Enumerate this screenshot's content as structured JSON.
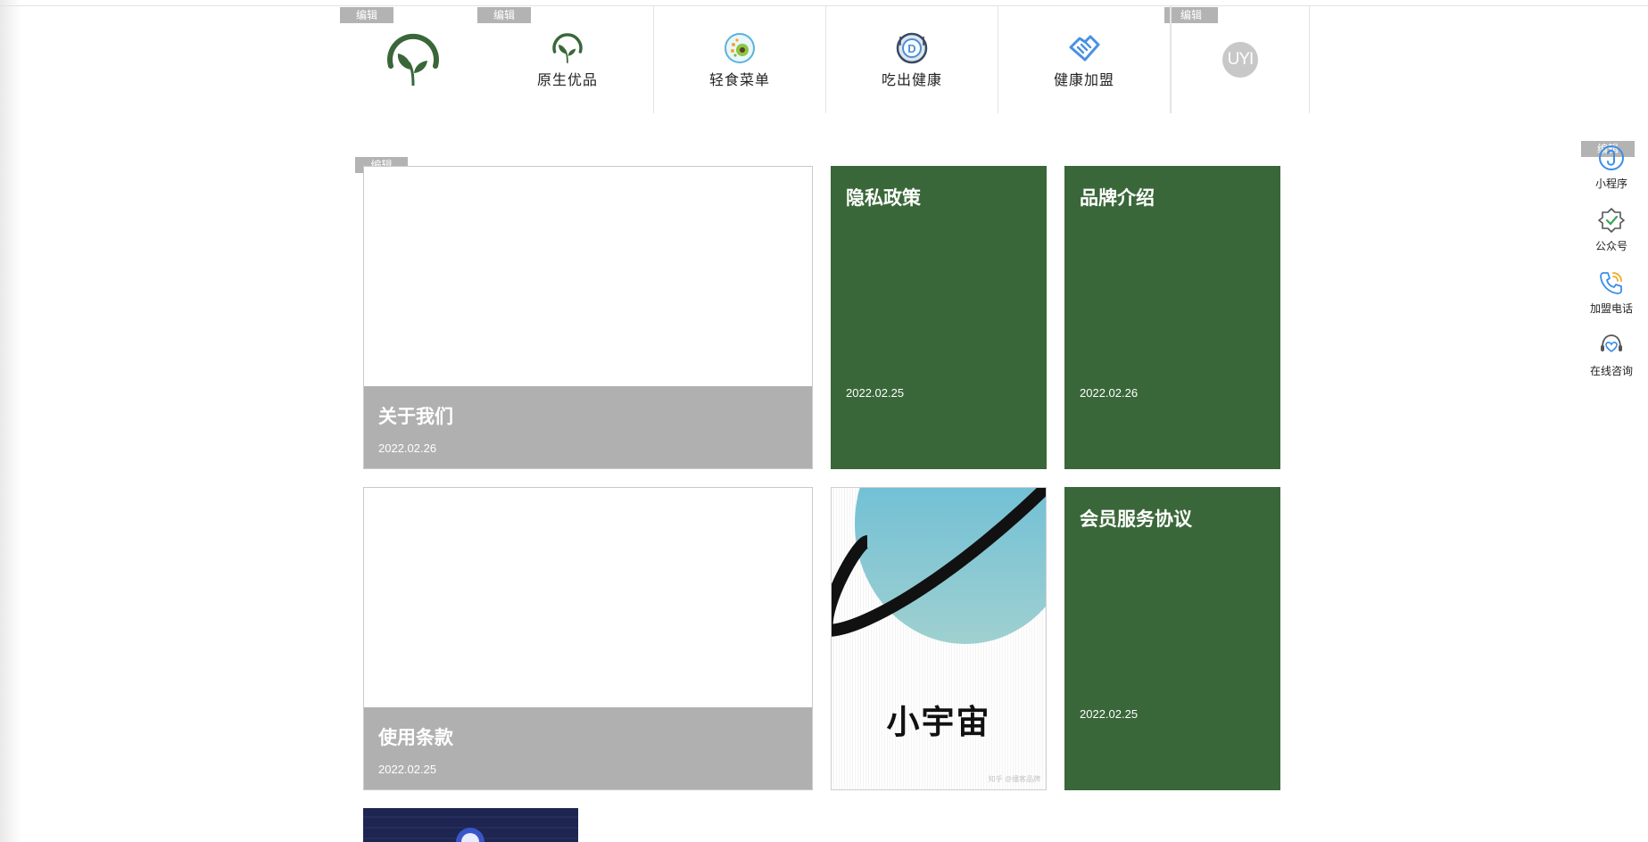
{
  "edit_label": "编辑",
  "brand_color": "#3a6739",
  "nav": {
    "items": [
      {
        "label": "原生优品",
        "icon": "leaf-icon"
      },
      {
        "label": "轻食菜单",
        "icon": "salad-bowl-icon"
      },
      {
        "label": "吃出健康",
        "icon": "dish-icon"
      },
      {
        "label": "健康加盟",
        "icon": "handshake-icon"
      }
    ],
    "avatar_text": "UYI"
  },
  "cards": {
    "about": {
      "title": "关于我们",
      "date": "2022.02.26"
    },
    "privacy": {
      "title": "隐私政策",
      "date": "2022.02.25"
    },
    "brand": {
      "title": "品牌介绍",
      "date": "2022.02.26"
    },
    "terms": {
      "title": "使用条款",
      "date": "2022.02.25"
    },
    "universe": {
      "caption": "小宇宙",
      "watermark": "知乎 @播客品牌"
    },
    "membership": {
      "title": "会员服务协议",
      "date": "2022.02.25"
    }
  },
  "side": {
    "items": [
      {
        "label": "小程序",
        "icon": "mini-program-icon"
      },
      {
        "label": "公众号",
        "icon": "official-account-icon"
      },
      {
        "label": "加盟电话",
        "icon": "phone-icon"
      },
      {
        "label": "在线咨询",
        "icon": "support-headset-icon"
      }
    ]
  }
}
